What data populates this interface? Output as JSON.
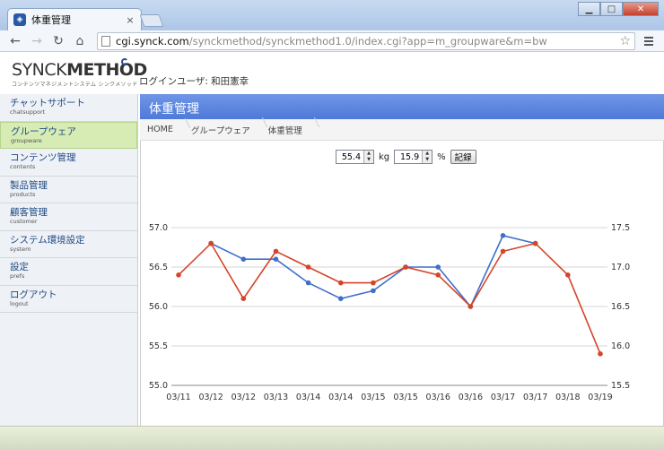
{
  "browser": {
    "tab_title": "体重管理",
    "tab_close": "×",
    "url_host": "cgi.synck.com",
    "url_path": "/synckmethod/synckmethod1.0/index.cgi?app=m_groupware&m=bw"
  },
  "header": {
    "logo_light": "SYNCK",
    "logo_bold": "METHOD",
    "logo_sub": "コンテンツマネジメントシステム シンクメソッド",
    "login_user": "ログインユーザ: 和田憲幸"
  },
  "sidebar": {
    "items": [
      {
        "label": "チャットサポート",
        "sub": "chatsupport"
      },
      {
        "label": "グループウェア",
        "sub": "groupware",
        "active": true
      },
      {
        "label": "コンテンツ管理",
        "sub": "contents"
      },
      {
        "label": "製品管理",
        "sub": "products"
      },
      {
        "label": "顧客管理",
        "sub": "customer"
      },
      {
        "label": "システム環境設定",
        "sub": "system"
      },
      {
        "label": "設定",
        "sub": "prefs"
      },
      {
        "label": "ログアウト",
        "sub": "logout"
      }
    ]
  },
  "main": {
    "title": "体重管理",
    "breadcrumb": [
      "HOME",
      "グループウェア",
      "体重管理"
    ]
  },
  "form": {
    "weight_value": "55.4",
    "weight_unit": "kg",
    "fat_value": "15.9",
    "fat_unit": "%",
    "record_label": "記録"
  },
  "colors": {
    "weight_series": "#3f6fc9",
    "fat_series": "#d4442a"
  },
  "chart_data": {
    "type": "line",
    "x": [
      "03/11",
      "03/12",
      "03/12",
      "03/13",
      "03/14",
      "03/14",
      "03/15",
      "03/15",
      "03/16",
      "03/16",
      "03/17",
      "03/17",
      "03/18",
      "03/19"
    ],
    "series": [
      {
        "axis": "left",
        "color": "#3f6fc9",
        "values": [
          null,
          56.8,
          56.6,
          56.6,
          56.3,
          56.1,
          56.2,
          56.5,
          56.5,
          56.0,
          56.9,
          56.8,
          null,
          null
        ]
      },
      {
        "axis": "right",
        "color": "#d4442a",
        "values": [
          16.9,
          17.3,
          16.6,
          17.2,
          17.0,
          16.8,
          16.8,
          17.0,
          16.9,
          16.5,
          17.2,
          17.3,
          16.9,
          15.9
        ]
      }
    ],
    "y_left": {
      "range": [
        55.0,
        57.0
      ],
      "ticks": [
        "55.0",
        "55.5",
        "56.0",
        "56.5",
        "57.0"
      ]
    },
    "y_right": {
      "range": [
        15.5,
        17.5
      ],
      "ticks": [
        "15.5",
        "16.0",
        "16.5",
        "17.0",
        "17.5"
      ]
    },
    "grid": true
  }
}
